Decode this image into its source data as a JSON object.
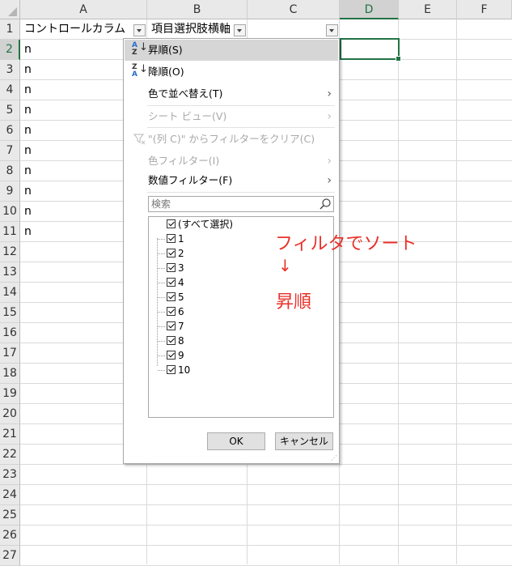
{
  "columns": [
    "A",
    "B",
    "C",
    "D",
    "E",
    "F"
  ],
  "selected_column": "D",
  "rows": [
    "1",
    "2",
    "3",
    "4",
    "5",
    "6",
    "7",
    "8",
    "9",
    "10",
    "11",
    "12",
    "13",
    "14",
    "15",
    "16",
    "17",
    "18",
    "19",
    "20",
    "21",
    "22",
    "23",
    "24",
    "25",
    "26",
    "27"
  ],
  "selected_row": "2",
  "header_cells": {
    "a1": "コントロールカラム",
    "b1": "項目選択肢横軸"
  },
  "column_a_values": [
    "n",
    "n",
    "n",
    "n",
    "n",
    "n",
    "n",
    "n",
    "n",
    "n"
  ],
  "menu": {
    "sort_asc": "昇順(S)",
    "sort_desc": "降順(O)",
    "sort_by_color": "色で並べ替え(T)",
    "sheet_view": "シート ビュー(V)",
    "clear_filter": "\"(列 C)\" からフィルターをクリア(C)",
    "color_filter": "色フィルター(I)",
    "number_filter": "数値フィルター(F)",
    "search_placeholder": "検索",
    "select_all": "(すべて選択)",
    "values": [
      "1",
      "2",
      "3",
      "4",
      "5",
      "6",
      "7",
      "8",
      "9",
      "10"
    ],
    "ok": "OK",
    "cancel": "キャンセル"
  },
  "annotation": {
    "line1": "フィルタでソート",
    "arrow": "↓",
    "line2": "昇順",
    "color": "#e8312a"
  },
  "colors": {
    "selection": "#217346",
    "highlight": "#d6d6d6"
  }
}
